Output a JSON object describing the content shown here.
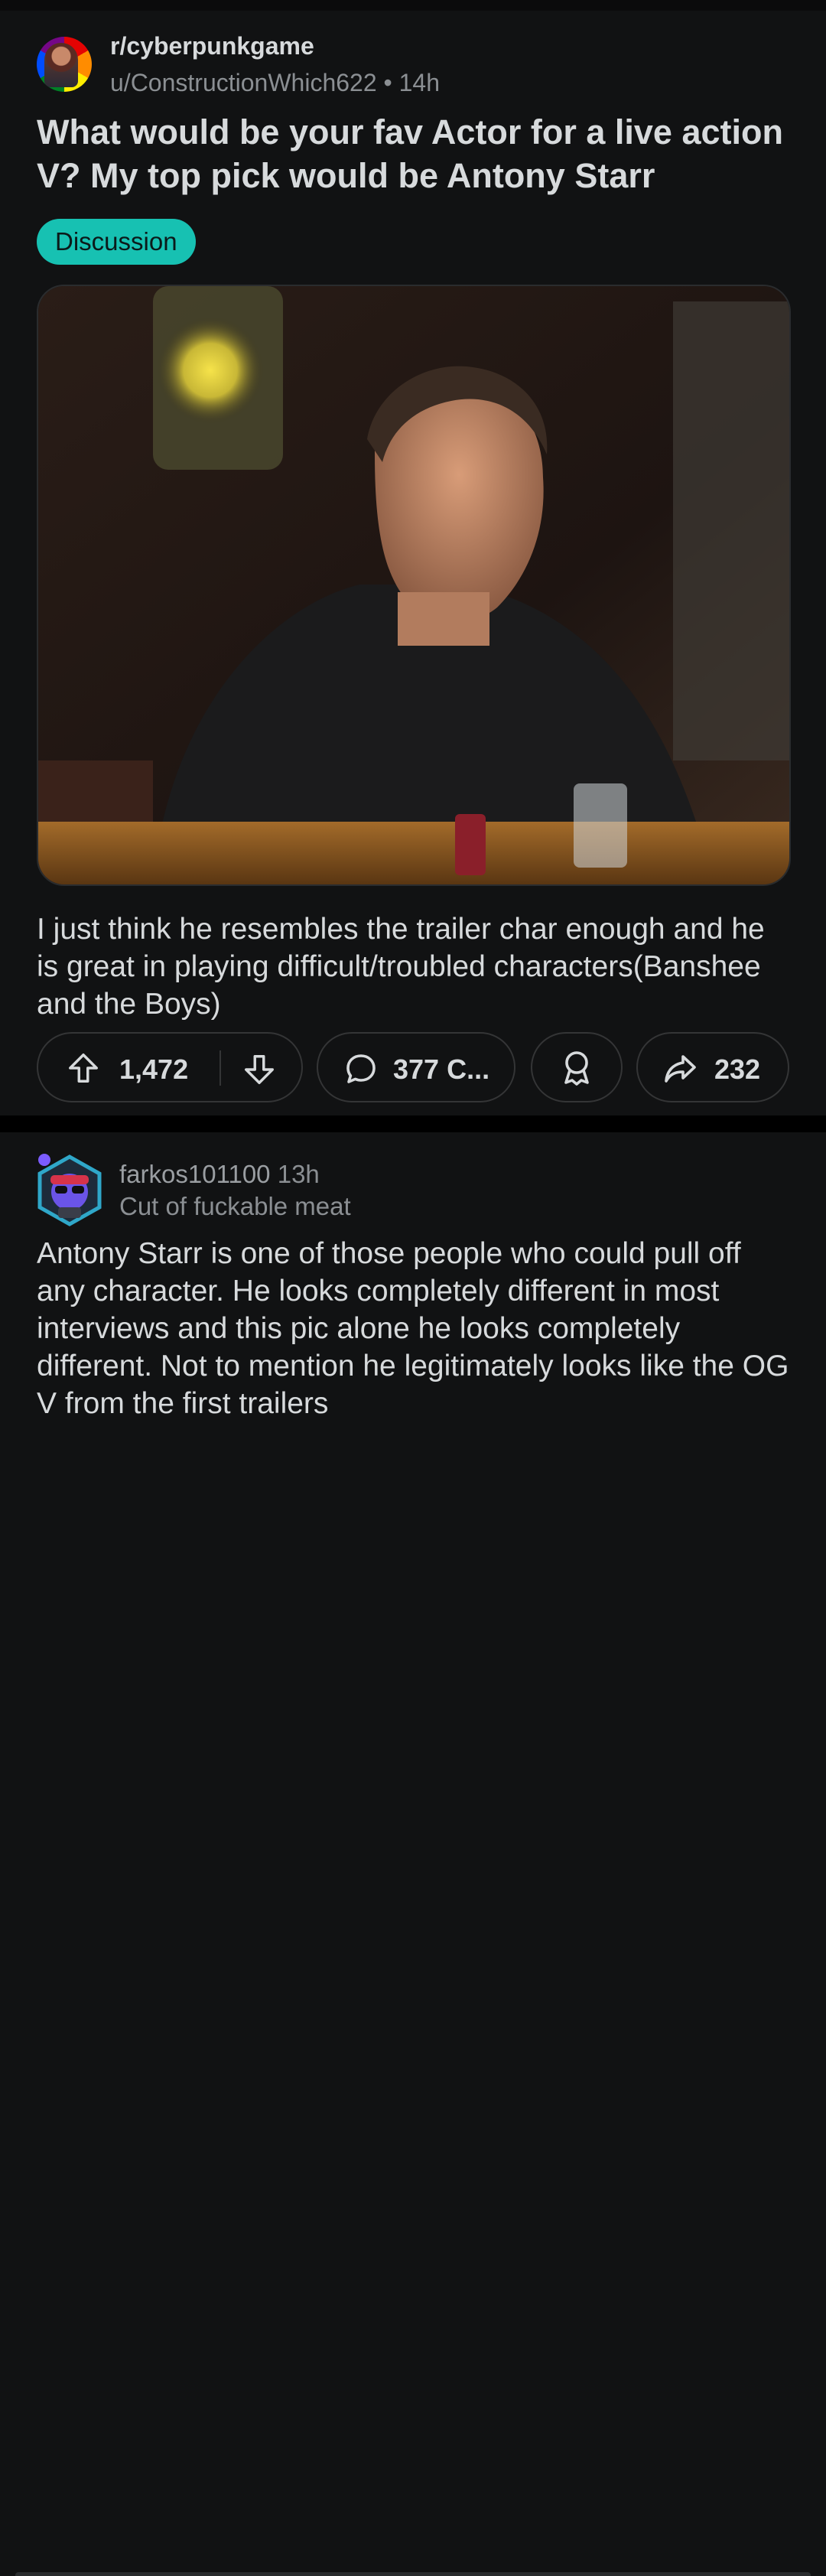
{
  "post": {
    "subreddit": "r/cyberpunkgame",
    "username": "u/ConstructionWhich622",
    "time": "• 14h",
    "title": "What would be your fav Actor for a live action V? My top pick would be Antony Starr",
    "flair": "Discussion",
    "body": "I just think he resembles the trailer char enough and he is great in playing difficult/troubled characters(Banshee and the Boys)",
    "image_alt": "Man in black t-shirt sitting at a bar table with a shot glass"
  },
  "actions": {
    "upvotes": "1,472",
    "comments": "377 C...",
    "shares": "232"
  },
  "comment": {
    "author": "farkos101100",
    "time": "13h",
    "flair": "Cut of fuckable meat",
    "text": "Antony Starr is one of those people who could pull off any character. He looks completely different in most interviews and this pic alone he looks completely different. Not to mention he legitimately looks like the OG V from the first trailers"
  },
  "colors": {
    "background": "#111213",
    "flair": "#17c1b2",
    "text": "#d7dadc",
    "muted": "#8b8f93"
  },
  "icons": [
    "upvote-icon",
    "downvote-icon",
    "comment-icon",
    "award-icon",
    "share-icon"
  ]
}
